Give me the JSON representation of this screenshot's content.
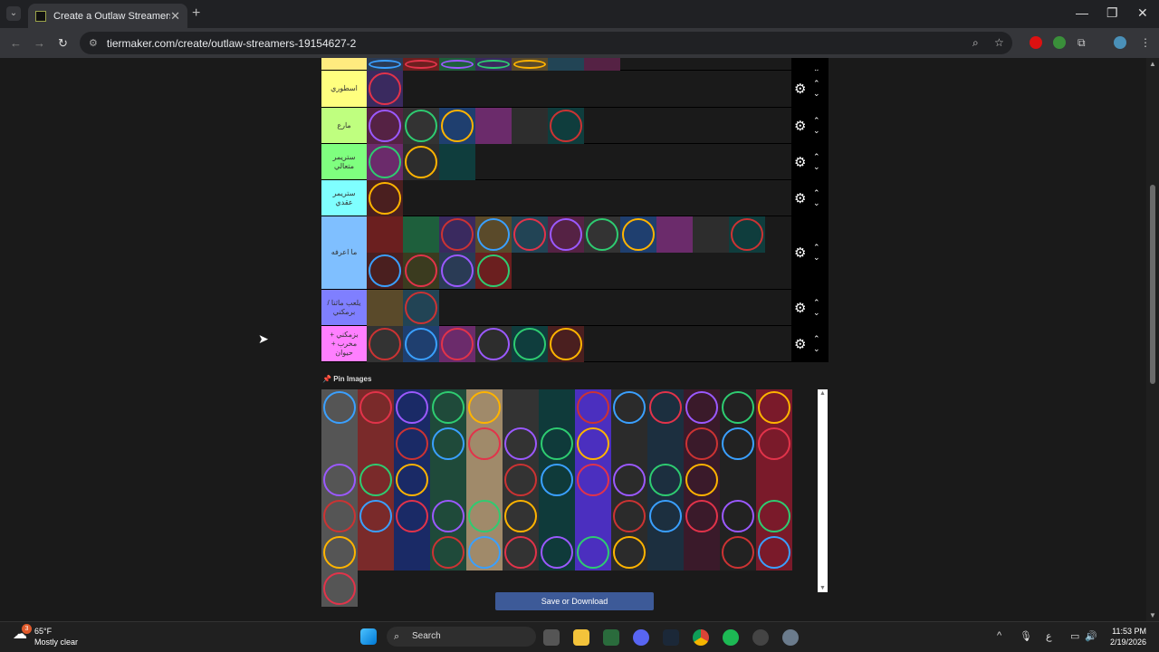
{
  "browser": {
    "tab_title": "Create a Outlaw Streamers Tier",
    "url": "tiermaker.com/create/outlaw-streamers-19154627-2",
    "tab_close": "✕",
    "new_tab": "+"
  },
  "tiers": [
    {
      "label": "",
      "color": "#ffeb7f",
      "count": 7
    },
    {
      "label": "اسطوري",
      "color": "#ffff7f",
      "count": 1
    },
    {
      "label": "مارع",
      "color": "#bfff7f",
      "count": 6
    },
    {
      "label": "ستريمر متعالي",
      "color": "#7fff7f",
      "count": 3
    },
    {
      "label": "ستريمر عقدي",
      "color": "#7fffff",
      "count": 1
    },
    {
      "label": "ما اعرفه",
      "color": "#7fbfff",
      "count": 15
    },
    {
      "label": "يلعب ماثنا / برمكني",
      "color": "#7f7fff",
      "count": 2
    },
    {
      "label": "بزمكني + مخرب + حيوان",
      "color": "#ff7fff",
      "count": 6
    }
  ],
  "pin": {
    "label": "Pin Images",
    "icon": "pushpin-icon"
  },
  "pool_count": 66,
  "save_label": "Save or Download",
  "taskbar": {
    "weather_temp": "65°F",
    "weather_desc": "Mostly clear",
    "weather_badge": "3",
    "search_label": "Search",
    "time": "11:53 PM",
    "date": "2/19/2026",
    "lang": "ع"
  }
}
